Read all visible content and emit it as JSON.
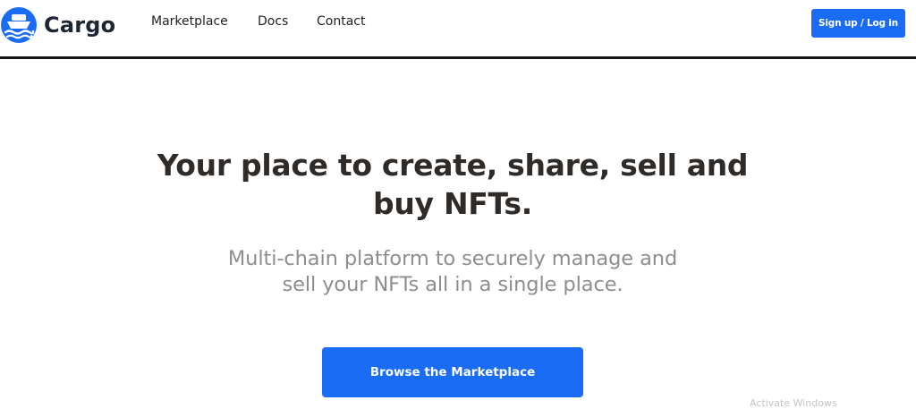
{
  "header": {
    "brand_name": "Cargo",
    "logo_icon": "ship-icon",
    "nav": [
      {
        "label": "Marketplace"
      },
      {
        "label": "Docs"
      },
      {
        "label": "Contact"
      }
    ],
    "signup_label": "Sign up / Log in"
  },
  "hero": {
    "title": "Your place to create, share, sell and buy NFTs.",
    "subtitle": "Multi-chain platform to securely manage and sell your NFTs all in a single place.",
    "cta_label": "Browse the Marketplace"
  },
  "overlay": {
    "watermark": "Activate Windows"
  },
  "colors": {
    "brand_blue": "#1a6cf4",
    "heading": "#2e2b28",
    "subtitle": "#8e8e8e",
    "logo_text": "#1c2733"
  }
}
